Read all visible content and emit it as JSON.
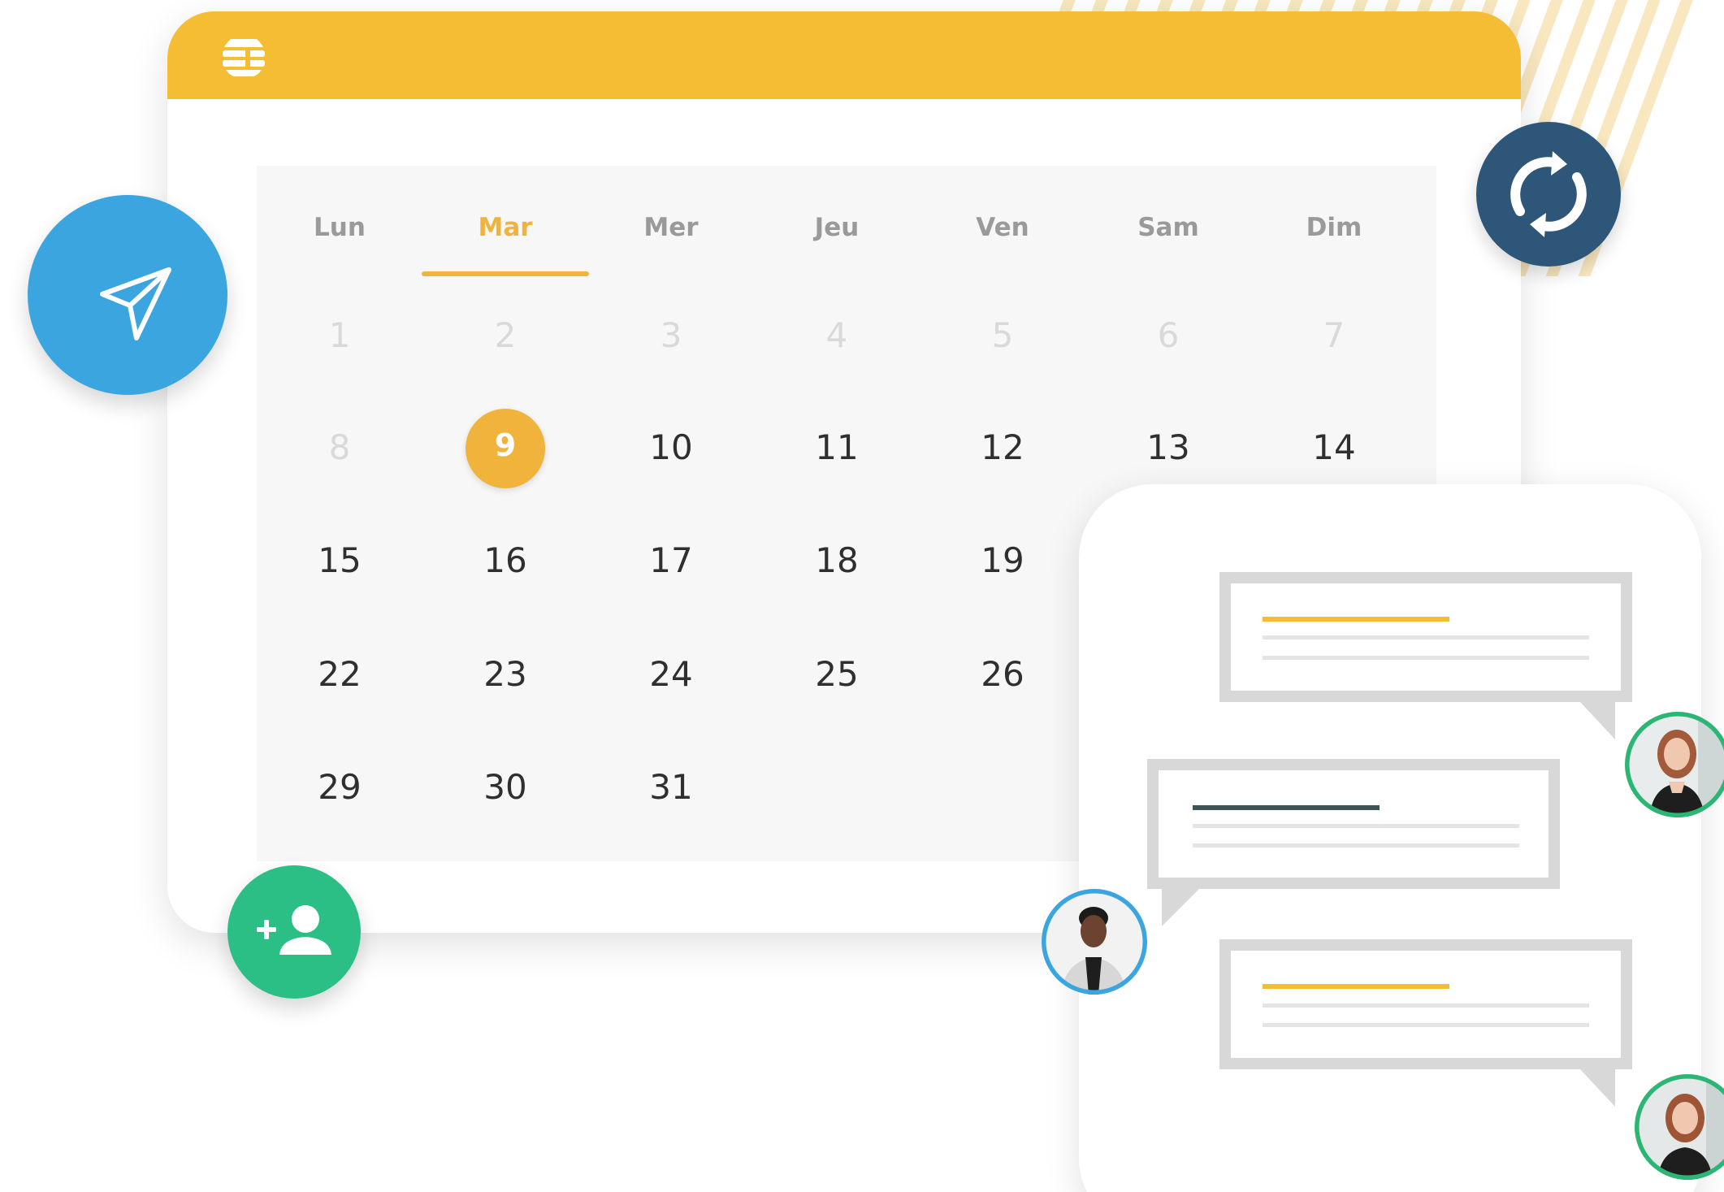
{
  "calendar": {
    "weekdays": [
      {
        "label": "Lun",
        "active": false
      },
      {
        "label": "Mar",
        "active": true
      },
      {
        "label": "Mer",
        "active": false
      },
      {
        "label": "Jeu",
        "active": false
      },
      {
        "label": "Ven",
        "active": false
      },
      {
        "label": "Sam",
        "active": false
      },
      {
        "label": "Dim",
        "active": false
      }
    ],
    "rows": [
      [
        "1",
        "2",
        "3",
        "4",
        "5",
        "6",
        "7"
      ],
      [
        "8",
        "9",
        "10",
        "11",
        "12",
        "13",
        "14"
      ],
      [
        "15",
        "16",
        "17",
        "18",
        "19",
        "",
        ""
      ],
      [
        "22",
        "23",
        "24",
        "25",
        "26",
        "",
        ""
      ],
      [
        "29",
        "30",
        "31",
        "",
        "",
        "",
        ""
      ]
    ],
    "selected_day": "9",
    "muted_days": [
      "1",
      "2",
      "3",
      "4",
      "5",
      "6",
      "7",
      "8"
    ]
  },
  "actions": {
    "send_icon": "paper-plane-icon",
    "sync_icon": "sync-icon",
    "add_user_icon": "add-user-icon"
  },
  "chat": {
    "messages": [
      {
        "side": "right",
        "accent": "yellow",
        "avatar": "person-woman-red-hair"
      },
      {
        "side": "left",
        "accent": "dark",
        "avatar": "person-woman-blazer"
      },
      {
        "side": "right",
        "accent": "yellow",
        "avatar": "person-woman-red-hair"
      }
    ]
  },
  "colors": {
    "brand_yellow": "#f4bd33",
    "accent_orange": "#f0b43c",
    "send_blue": "#3ba5e0",
    "sync_navy": "#2e5679",
    "add_green": "#2bbf85",
    "bubble_gray": "#d8d8d8",
    "dark_accent": "#3b5457"
  }
}
